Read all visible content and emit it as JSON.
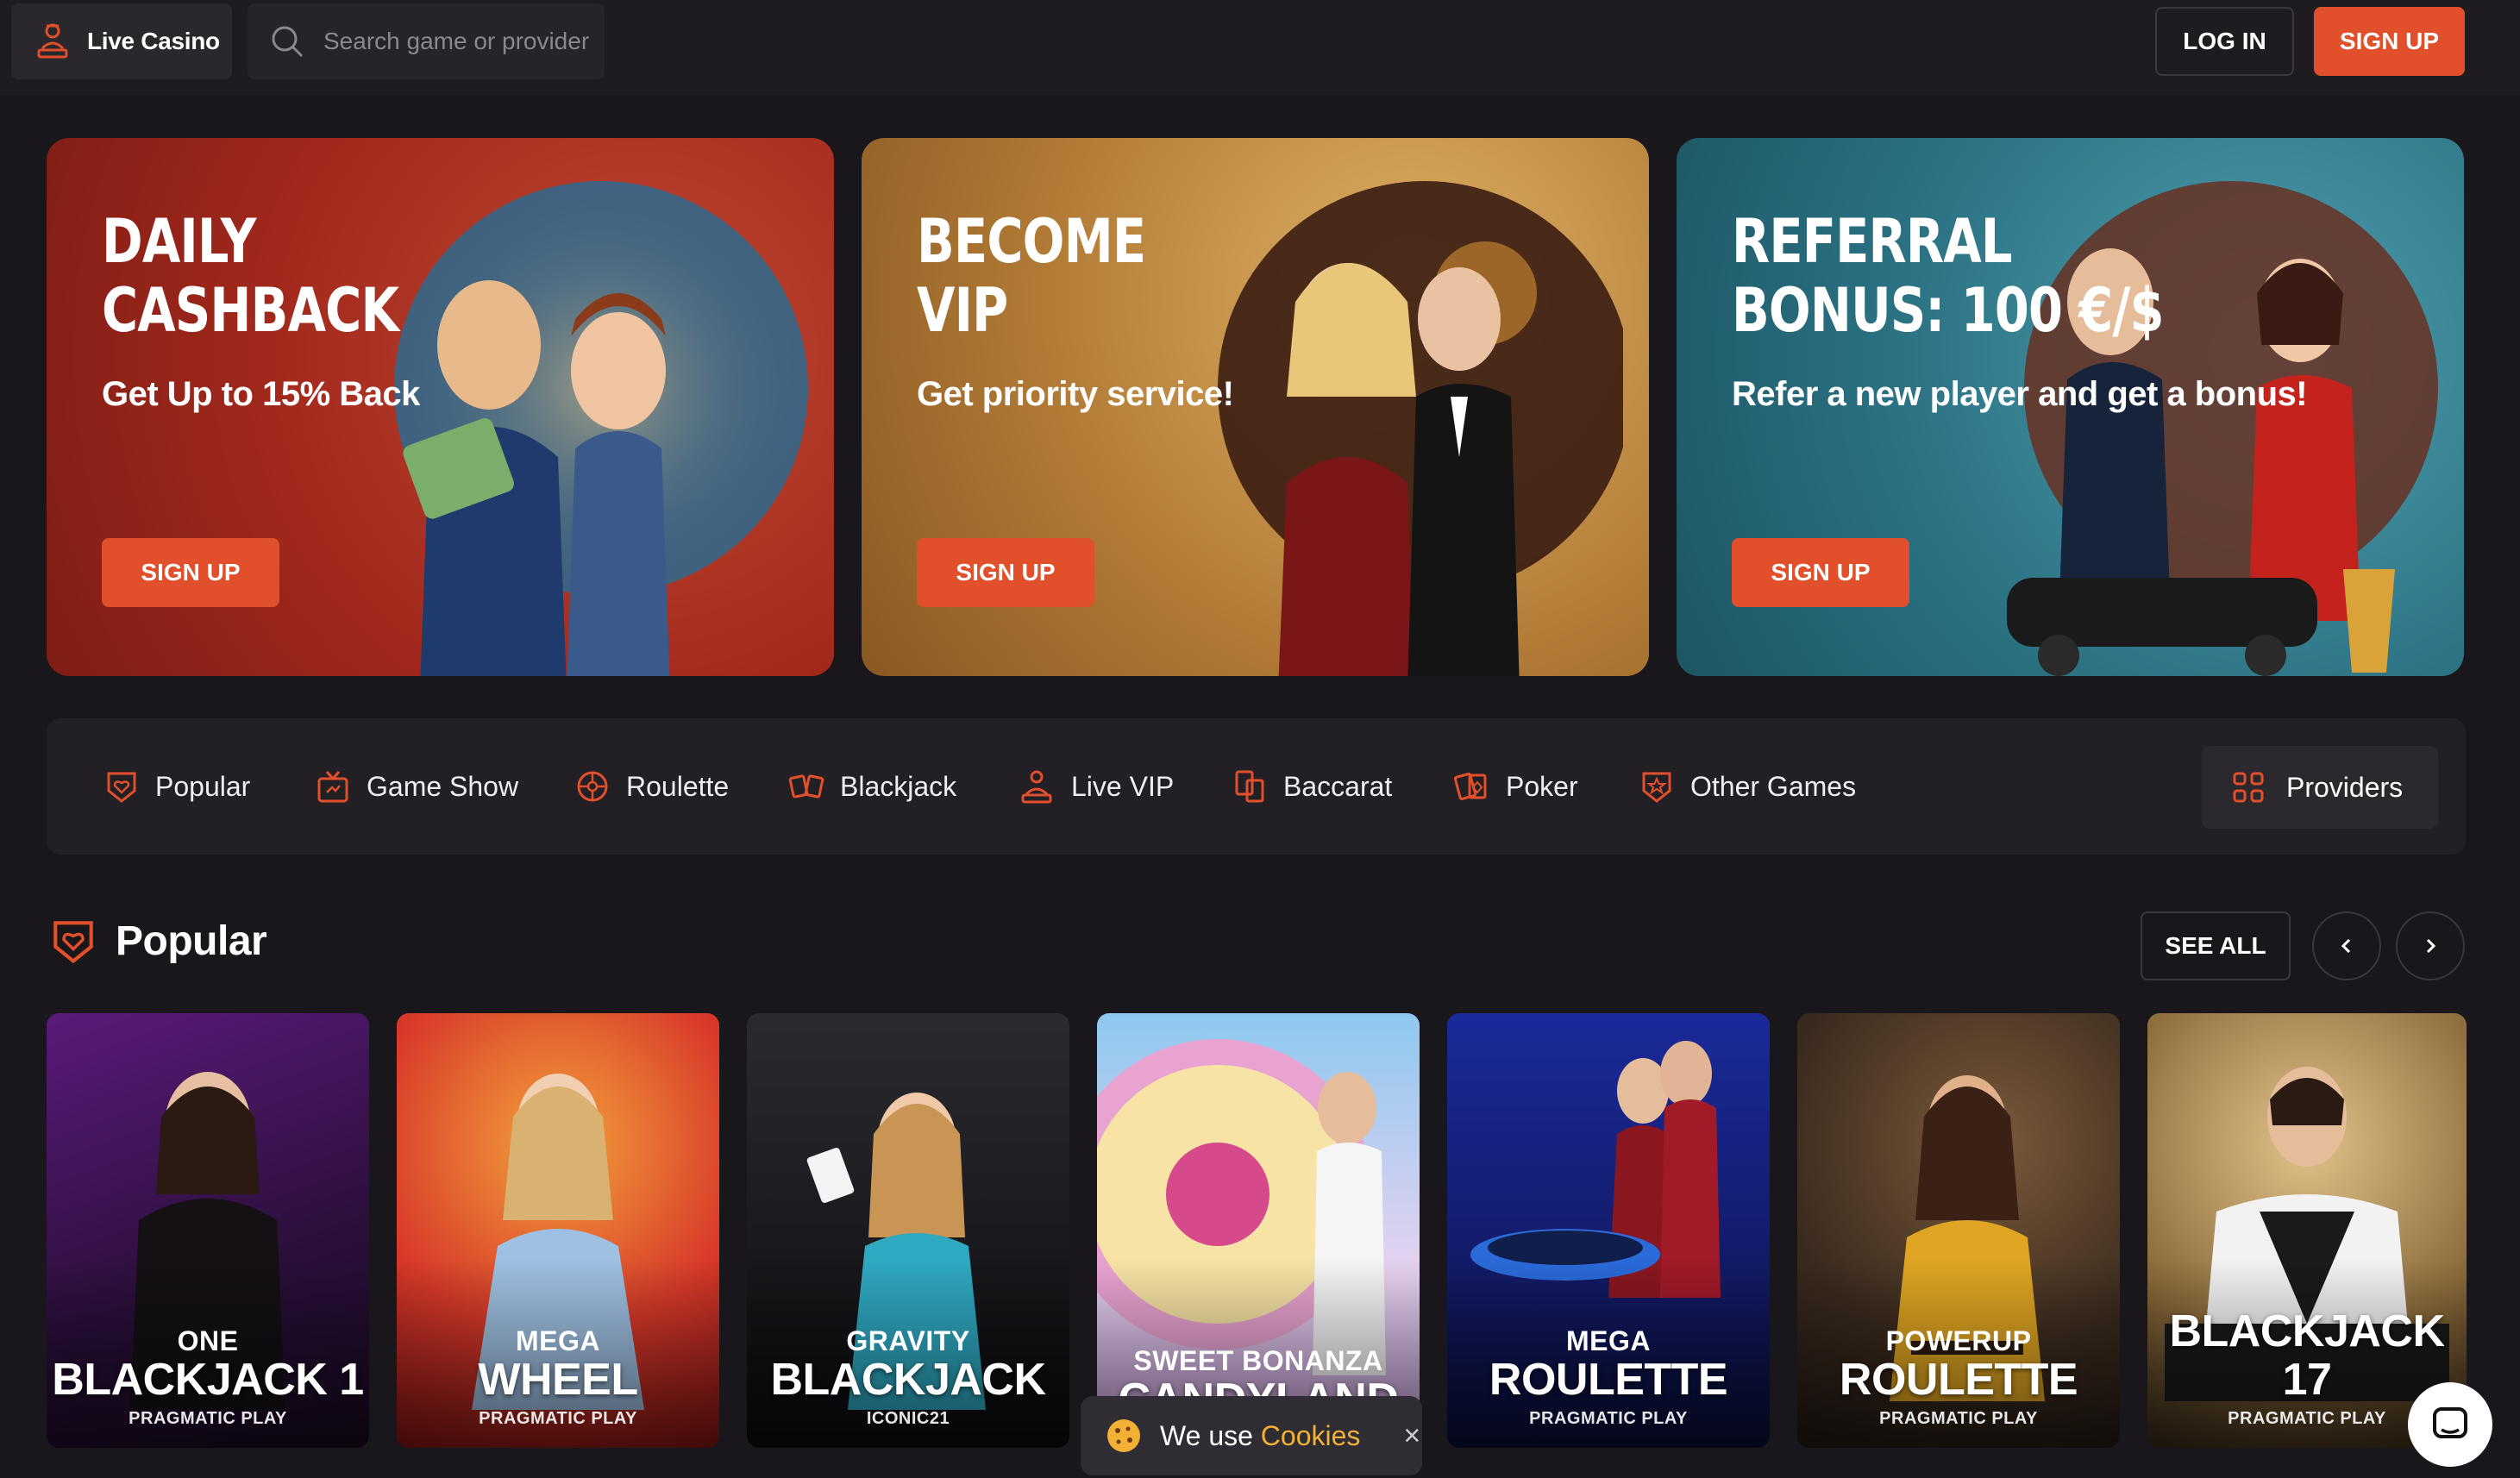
{
  "header": {
    "live_label": "Live Casino",
    "search_placeholder": "Search game or provider",
    "login": "LOG IN",
    "signup": "SIGN UP"
  },
  "colors": {
    "accent": "#e1502a",
    "bg": "#19171b",
    "cookie_link": "#f2b035"
  },
  "promos": [
    {
      "title1": "DAILY",
      "title2": "CASHBACK",
      "subtitle": "Get Up to 15% Back",
      "button": "SIGN UP"
    },
    {
      "title1": "BECOME",
      "title2": "VIP",
      "subtitle": "Get priority service!",
      "button": "SIGN UP"
    },
    {
      "title1": "REFERRAL",
      "title2": "BONUS: 100 €/$",
      "subtitle": "Refer a new player and get a bonus!",
      "button": "SIGN UP"
    }
  ],
  "categories": [
    {
      "label": "Popular",
      "icon": "heart-shield-icon"
    },
    {
      "label": "Game Show",
      "icon": "tv-icon"
    },
    {
      "label": "Roulette",
      "icon": "roulette-icon"
    },
    {
      "label": "Blackjack",
      "icon": "cards-icon"
    },
    {
      "label": "Live VIP",
      "icon": "dealer-icon"
    },
    {
      "label": "Baccarat",
      "icon": "baccarat-icon"
    },
    {
      "label": "Poker",
      "icon": "poker-icon"
    },
    {
      "label": "Other Games",
      "icon": "star-shield-icon"
    }
  ],
  "providers_label": "Providers",
  "section": {
    "title": "Popular",
    "see_all": "SEE ALL"
  },
  "games": [
    {
      "l1": "ONE",
      "l2": "BLACKJACK 1",
      "l3": "PRAGMATIC PLAY"
    },
    {
      "l1": "MEGA",
      "l2": "WHEEL",
      "l3": "PRAGMATIC PLAY"
    },
    {
      "l1": "GRAVITY",
      "l2": "BLACKJACK",
      "l3": "ICONIC21"
    },
    {
      "l1": "SWEET BONANZA",
      "l2": "CANDYLAND",
      "l3": ""
    },
    {
      "l1": "MEGA",
      "l2": "ROULETTE",
      "l3": "PRAGMATIC PLAY"
    },
    {
      "l1": "POWERUP",
      "l2": "ROULETTE",
      "l3": "PRAGMATIC PLAY"
    },
    {
      "l1": "",
      "l2": "BLACKJACK 17",
      "l3": "PRAGMATIC PLAY"
    }
  ],
  "cookie": {
    "text": "We use",
    "link": "Cookies",
    "close": "×"
  }
}
